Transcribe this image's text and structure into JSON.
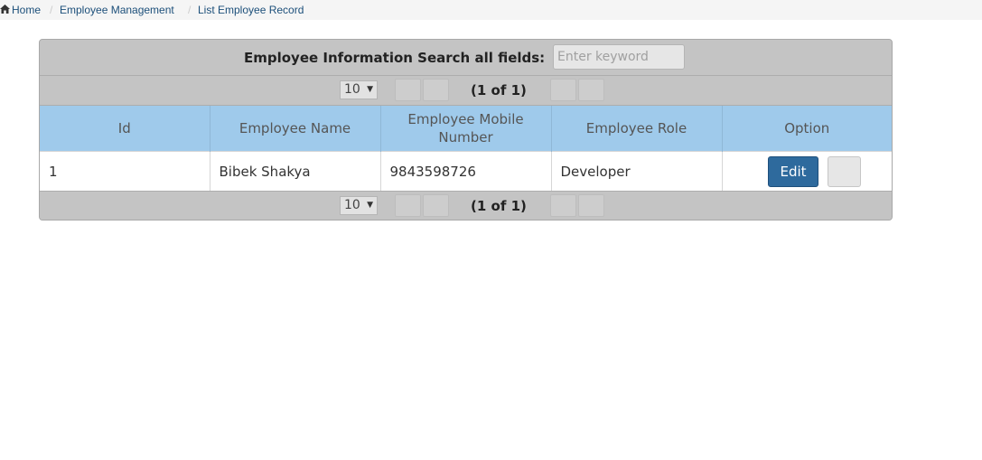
{
  "breadcrumb": {
    "items": [
      {
        "label": "Home",
        "icon": "home-icon"
      },
      {
        "label": "Employee Management"
      },
      {
        "label": "List Employee Record"
      }
    ],
    "separator": "/"
  },
  "panel": {
    "title": "Employee Information Search all fields:",
    "search": {
      "value": "",
      "placeholder": "Enter keyword"
    },
    "paginator": {
      "rows_per_page": "10",
      "page_report": "(1 of 1)"
    },
    "table": {
      "columns": [
        "Id",
        "Employee Name",
        "Employee Mobile Number",
        "Employee Role",
        "Option"
      ],
      "rows": [
        {
          "id": "1",
          "name": "Bibek Shakya",
          "mobile": "9843598726",
          "role": "Developer",
          "edit_label": "Edit"
        }
      ]
    }
  },
  "colors": {
    "header_bg": "#c4c4c4",
    "table_header_bg": "#9fcaeb",
    "edit_button_bg": "#2e6a9d",
    "breadcrumb_link": "#1c4f7a"
  }
}
